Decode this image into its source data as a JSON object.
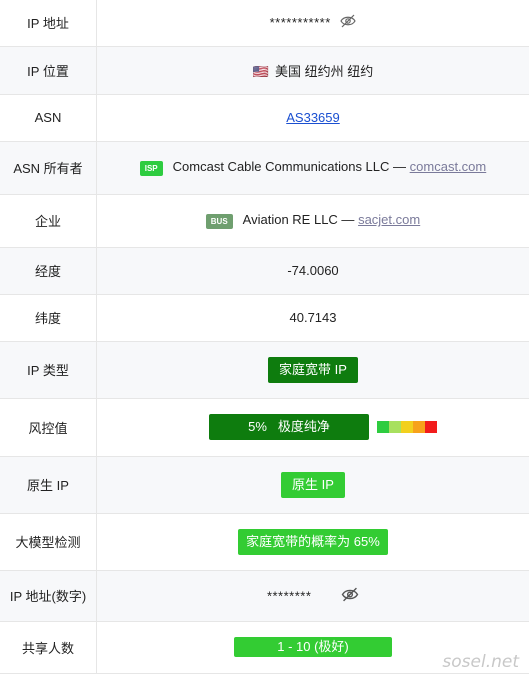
{
  "rows": {
    "ip": {
      "label": "IP 地址",
      "value": "***********"
    },
    "location": {
      "label": "IP 位置",
      "flag": "🇺🇸",
      "value": "美国 纽约州 纽约"
    },
    "asn": {
      "label": "ASN",
      "value": "AS33659"
    },
    "asn_owner": {
      "label": "ASN 所有者",
      "badge": "ISP",
      "name": "Comcast Cable Communications LLC —",
      "domain": "comcast.com"
    },
    "company": {
      "label": "企业",
      "badge": "BUS",
      "name": "Aviation RE LLC —",
      "domain": "sacjet.com"
    },
    "longitude": {
      "label": "经度",
      "value": "-74.0060"
    },
    "latitude": {
      "label": "纬度",
      "value": "40.7143"
    },
    "ip_type": {
      "label": "IP 类型",
      "value": "家庭宽带 IP"
    },
    "risk": {
      "label": "风控值",
      "percent": "5%",
      "desc": "极度纯净"
    },
    "native": {
      "label": "原生 IP",
      "value": "原生 IP"
    },
    "llm": {
      "label": "大模型检测",
      "value": "家庭宽带的概率为 65%"
    },
    "ip_num": {
      "label": "IP 地址(数字)",
      "value": "********"
    },
    "shared": {
      "label": "共享人数",
      "value": "1 - 10 (极好)"
    }
  },
  "colors": {
    "dark_green": "#0e7c0e",
    "bright_green": "#33cc33",
    "isp_badge": "#2ecc40",
    "bus_badge": "#6f9f6f",
    "risk_scale": [
      "#2ecc40",
      "#a8e05f",
      "#f2d01e",
      "#f7a21b",
      "#f21c1c"
    ]
  },
  "watermark": "sosel.net"
}
